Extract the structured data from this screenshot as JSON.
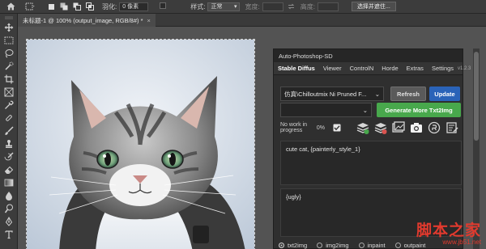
{
  "options_bar": {
    "feather_label": "羽化:",
    "feather_value": "0 像素",
    "style_label": "样式:",
    "style_value": "正常",
    "width_label": "宽度:",
    "height_label": "高度:",
    "select_subject_label": "选择并遮住..."
  },
  "document_tab": {
    "title": "未标题-1 @ 100% (output_image, RGB/8#) *",
    "close_glyph": "×"
  },
  "panel": {
    "title": "Auto-Photoshop-SD",
    "version": "v1.2.3",
    "tabs": [
      "Stable Diffus",
      "Viewer",
      "ControlN",
      "Horde",
      "Extras",
      "Settings"
    ],
    "model_select": "仿真\\Chilloutmix Ni Pruned F...",
    "refresh_label": "Refresh",
    "update_label": "Update",
    "generate_label": "Generate More Txt2Img",
    "progress_label": "No work in progress",
    "progress_value": "0%",
    "prompt": "cute cat, {painterly_style_1}",
    "negative_prompt": "{ugly}",
    "modes": [
      "txt2img",
      "img2img",
      "inpaint",
      "outpaint"
    ],
    "selected_mode": "txt2img"
  },
  "watermark": {
    "main": "脚本之家",
    "url": "www.jb51.net"
  },
  "colors": {
    "accent_blue": "#2a63b8",
    "accent_green": "#48a84c",
    "watermark_red": "#e23a2e"
  }
}
